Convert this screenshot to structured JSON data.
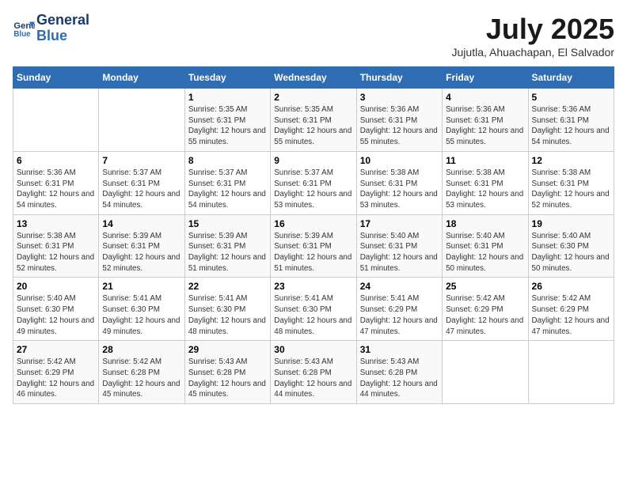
{
  "header": {
    "logo_line1": "General",
    "logo_line2": "Blue",
    "month_title": "July 2025",
    "location": "Jujutla, Ahuachapan, El Salvador"
  },
  "days_of_week": [
    "Sunday",
    "Monday",
    "Tuesday",
    "Wednesday",
    "Thursday",
    "Friday",
    "Saturday"
  ],
  "weeks": [
    [
      {
        "day": "",
        "sunrise": "",
        "sunset": "",
        "daylight": ""
      },
      {
        "day": "",
        "sunrise": "",
        "sunset": "",
        "daylight": ""
      },
      {
        "day": "1",
        "sunrise": "Sunrise: 5:35 AM",
        "sunset": "Sunset: 6:31 PM",
        "daylight": "Daylight: 12 hours and 55 minutes."
      },
      {
        "day": "2",
        "sunrise": "Sunrise: 5:35 AM",
        "sunset": "Sunset: 6:31 PM",
        "daylight": "Daylight: 12 hours and 55 minutes."
      },
      {
        "day": "3",
        "sunrise": "Sunrise: 5:36 AM",
        "sunset": "Sunset: 6:31 PM",
        "daylight": "Daylight: 12 hours and 55 minutes."
      },
      {
        "day": "4",
        "sunrise": "Sunrise: 5:36 AM",
        "sunset": "Sunset: 6:31 PM",
        "daylight": "Daylight: 12 hours and 55 minutes."
      },
      {
        "day": "5",
        "sunrise": "Sunrise: 5:36 AM",
        "sunset": "Sunset: 6:31 PM",
        "daylight": "Daylight: 12 hours and 54 minutes."
      }
    ],
    [
      {
        "day": "6",
        "sunrise": "Sunrise: 5:36 AM",
        "sunset": "Sunset: 6:31 PM",
        "daylight": "Daylight: 12 hours and 54 minutes."
      },
      {
        "day": "7",
        "sunrise": "Sunrise: 5:37 AM",
        "sunset": "Sunset: 6:31 PM",
        "daylight": "Daylight: 12 hours and 54 minutes."
      },
      {
        "day": "8",
        "sunrise": "Sunrise: 5:37 AM",
        "sunset": "Sunset: 6:31 PM",
        "daylight": "Daylight: 12 hours and 54 minutes."
      },
      {
        "day": "9",
        "sunrise": "Sunrise: 5:37 AM",
        "sunset": "Sunset: 6:31 PM",
        "daylight": "Daylight: 12 hours and 53 minutes."
      },
      {
        "day": "10",
        "sunrise": "Sunrise: 5:38 AM",
        "sunset": "Sunset: 6:31 PM",
        "daylight": "Daylight: 12 hours and 53 minutes."
      },
      {
        "day": "11",
        "sunrise": "Sunrise: 5:38 AM",
        "sunset": "Sunset: 6:31 PM",
        "daylight": "Daylight: 12 hours and 53 minutes."
      },
      {
        "day": "12",
        "sunrise": "Sunrise: 5:38 AM",
        "sunset": "Sunset: 6:31 PM",
        "daylight": "Daylight: 12 hours and 52 minutes."
      }
    ],
    [
      {
        "day": "13",
        "sunrise": "Sunrise: 5:38 AM",
        "sunset": "Sunset: 6:31 PM",
        "daylight": "Daylight: 12 hours and 52 minutes."
      },
      {
        "day": "14",
        "sunrise": "Sunrise: 5:39 AM",
        "sunset": "Sunset: 6:31 PM",
        "daylight": "Daylight: 12 hours and 52 minutes."
      },
      {
        "day": "15",
        "sunrise": "Sunrise: 5:39 AM",
        "sunset": "Sunset: 6:31 PM",
        "daylight": "Daylight: 12 hours and 51 minutes."
      },
      {
        "day": "16",
        "sunrise": "Sunrise: 5:39 AM",
        "sunset": "Sunset: 6:31 PM",
        "daylight": "Daylight: 12 hours and 51 minutes."
      },
      {
        "day": "17",
        "sunrise": "Sunrise: 5:40 AM",
        "sunset": "Sunset: 6:31 PM",
        "daylight": "Daylight: 12 hours and 51 minutes."
      },
      {
        "day": "18",
        "sunrise": "Sunrise: 5:40 AM",
        "sunset": "Sunset: 6:31 PM",
        "daylight": "Daylight: 12 hours and 50 minutes."
      },
      {
        "day": "19",
        "sunrise": "Sunrise: 5:40 AM",
        "sunset": "Sunset: 6:30 PM",
        "daylight": "Daylight: 12 hours and 50 minutes."
      }
    ],
    [
      {
        "day": "20",
        "sunrise": "Sunrise: 5:40 AM",
        "sunset": "Sunset: 6:30 PM",
        "daylight": "Daylight: 12 hours and 49 minutes."
      },
      {
        "day": "21",
        "sunrise": "Sunrise: 5:41 AM",
        "sunset": "Sunset: 6:30 PM",
        "daylight": "Daylight: 12 hours and 49 minutes."
      },
      {
        "day": "22",
        "sunrise": "Sunrise: 5:41 AM",
        "sunset": "Sunset: 6:30 PM",
        "daylight": "Daylight: 12 hours and 48 minutes."
      },
      {
        "day": "23",
        "sunrise": "Sunrise: 5:41 AM",
        "sunset": "Sunset: 6:30 PM",
        "daylight": "Daylight: 12 hours and 48 minutes."
      },
      {
        "day": "24",
        "sunrise": "Sunrise: 5:41 AM",
        "sunset": "Sunset: 6:29 PM",
        "daylight": "Daylight: 12 hours and 47 minutes."
      },
      {
        "day": "25",
        "sunrise": "Sunrise: 5:42 AM",
        "sunset": "Sunset: 6:29 PM",
        "daylight": "Daylight: 12 hours and 47 minutes."
      },
      {
        "day": "26",
        "sunrise": "Sunrise: 5:42 AM",
        "sunset": "Sunset: 6:29 PM",
        "daylight": "Daylight: 12 hours and 47 minutes."
      }
    ],
    [
      {
        "day": "27",
        "sunrise": "Sunrise: 5:42 AM",
        "sunset": "Sunset: 6:29 PM",
        "daylight": "Daylight: 12 hours and 46 minutes."
      },
      {
        "day": "28",
        "sunrise": "Sunrise: 5:42 AM",
        "sunset": "Sunset: 6:28 PM",
        "daylight": "Daylight: 12 hours and 45 minutes."
      },
      {
        "day": "29",
        "sunrise": "Sunrise: 5:43 AM",
        "sunset": "Sunset: 6:28 PM",
        "daylight": "Daylight: 12 hours and 45 minutes."
      },
      {
        "day": "30",
        "sunrise": "Sunrise: 5:43 AM",
        "sunset": "Sunset: 6:28 PM",
        "daylight": "Daylight: 12 hours and 44 minutes."
      },
      {
        "day": "31",
        "sunrise": "Sunrise: 5:43 AM",
        "sunset": "Sunset: 6:28 PM",
        "daylight": "Daylight: 12 hours and 44 minutes."
      },
      {
        "day": "",
        "sunrise": "",
        "sunset": "",
        "daylight": ""
      },
      {
        "day": "",
        "sunrise": "",
        "sunset": "",
        "daylight": ""
      }
    ]
  ]
}
